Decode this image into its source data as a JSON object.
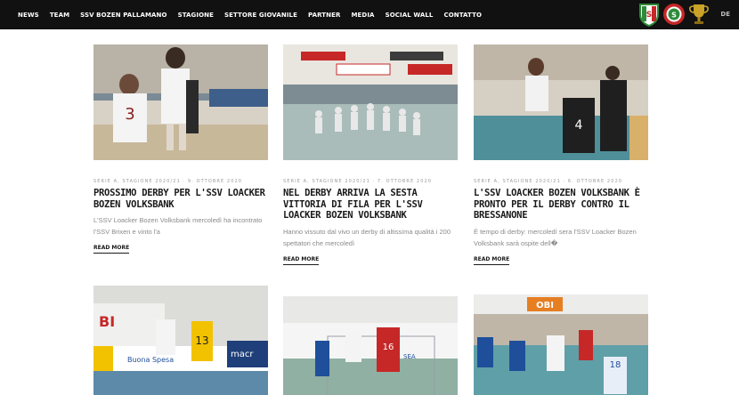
{
  "nav": {
    "items": [
      "NEWS",
      "TEAM",
      "SSV BOZEN PALLAMANO",
      "STAGIONE",
      "SETTORE GIOVANILE",
      "PARTNER",
      "MEDIA",
      "SOCIAL WALL",
      "CONTATTO"
    ],
    "lang": "DE"
  },
  "badges": [
    {
      "name": "scudetto-badge",
      "letter": "S",
      "color": "#2e8b3a"
    },
    {
      "name": "coppa-italia-badge",
      "letter": "S",
      "color": "#c62828"
    },
    {
      "name": "trophy-icon",
      "color": "#c9a227"
    }
  ],
  "posts": [
    {
      "meta": "SERIE A, STAGIONE 2020/21 · 9. OTTOBRE 2020",
      "title": "PROSSIMO DERBY PER L'SSV LOACKER BOZEN VOLKSBANK",
      "excerpt": "L'SSV Loacker Bozen Volksbank mercoledì ha incontrato l'SSV Brixen e vinto l'a",
      "more": "READ MORE"
    },
    {
      "meta": "SERIE A, STAGIONE 2020/21 · 7. OTTOBRE 2020",
      "title": "NEL DERBY ARRIVA LA SESTA VITTORIA DI FILA PER L'SSV LOACKER BOZEN VOLKSBANK",
      "excerpt": "Hanno vissuto dal vivo un derby di altissima qualità i 200 spettatori che mercoledì",
      "more": "READ MORE"
    },
    {
      "meta": "SERIE A, STAGIONE 2020/21 · 6. OTTOBRE 2020",
      "title": "L'SSV LOACKER BOZEN VOLKSBANK È PRONTO PER IL DERBY CONTRO IL BRESSANONE",
      "excerpt": "È tempo di derby: mercoledì sera l'SSV Loacker Bozen Volksbank sarà ospite dell�",
      "more": "READ MORE"
    },
    {
      "meta": "",
      "title": "",
      "excerpt": "",
      "more": ""
    },
    {
      "meta": "",
      "title": "",
      "excerpt": "",
      "more": ""
    },
    {
      "meta": "",
      "title": "",
      "excerpt": "",
      "more": ""
    }
  ]
}
